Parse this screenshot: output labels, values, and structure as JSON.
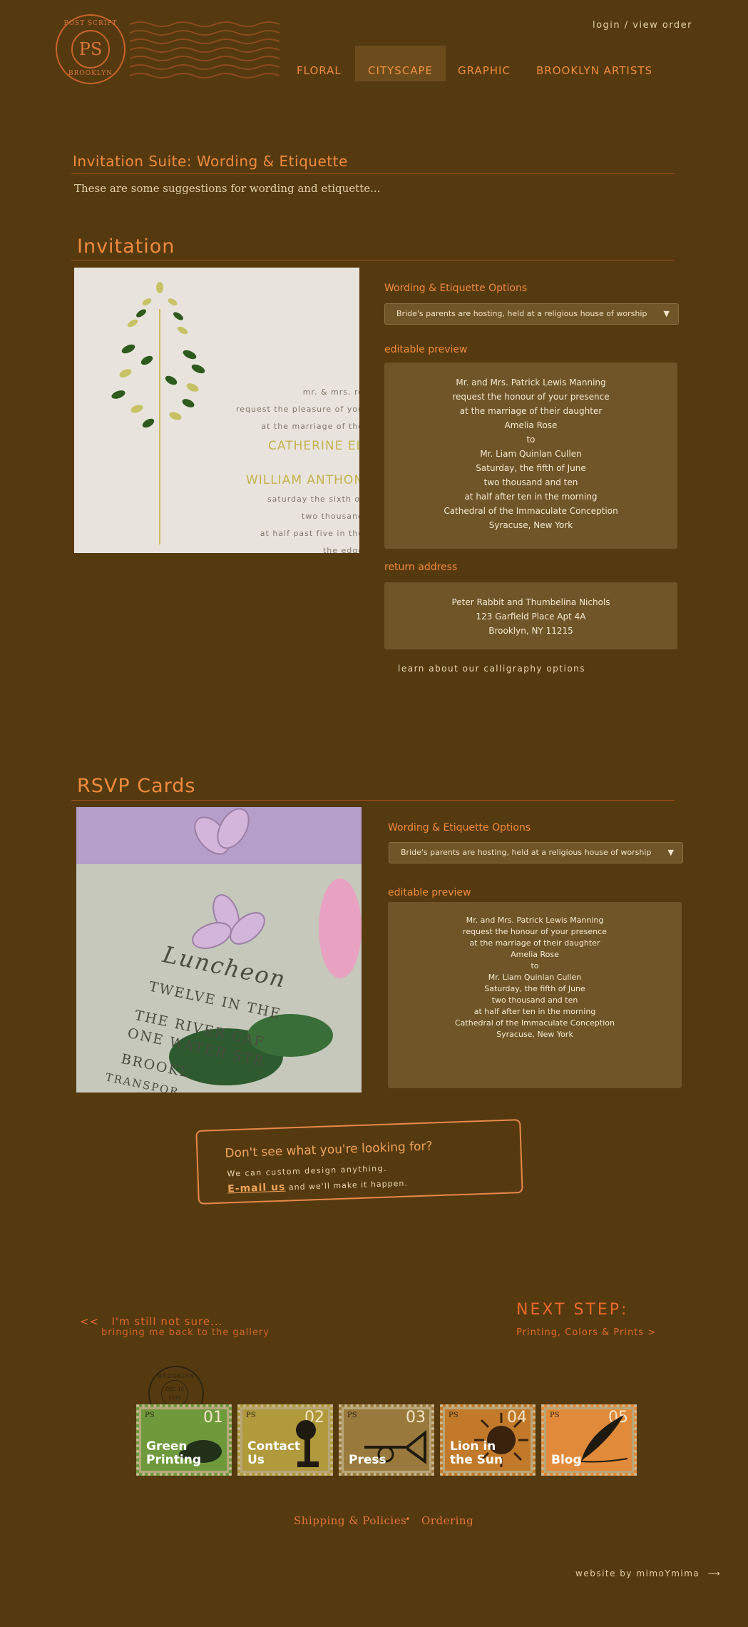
{
  "header": {
    "logo": {
      "top": "POST SCRIPT",
      "mono": "PS",
      "bottom": "BROOKLYN"
    },
    "login": "login / view order",
    "nav": [
      "FLORAL",
      "CITYSCAPE",
      "GRAPHIC",
      "BROOKLYN ARTISTS"
    ],
    "active_nav": "CITYSCAPE"
  },
  "page": {
    "title": "Invitation Suite: Wording & Etiquette",
    "intro": "These are some suggestions for wording and etiquette..."
  },
  "invitation": {
    "title": "Invitation",
    "photo_text": {
      "line1": "mr. & mrs. ro",
      "line2": "request the pleasure of you",
      "line3": "at the marriage of the",
      "name1": "CATHERINE EL",
      "name2": "WILLIAM ANTHON",
      "line4": "saturday the sixth of",
      "line5": "two thousand",
      "line6": "at half past five in the",
      "line7": "the edge"
    },
    "options_label": "Wording & Etiquette Options",
    "option_selected": "Bride's parents are hosting, held at a religious house of worship",
    "preview_label": "editable preview",
    "preview_lines": [
      "Mr. and Mrs. Patrick Lewis Manning",
      "request the honour of your presence",
      "at the marriage of their daughter",
      "Amelia Rose",
      "to",
      "Mr. Liam Quinlan Cullen",
      "Saturday, the fifth of June",
      "two thousand and ten",
      "at half after ten in the morning",
      "Cathedral of the Immaculate Conception",
      "Syracuse, New York"
    ],
    "return_label": "return address",
    "return_lines": [
      "Peter Rabbit and Thumbelina Nichols",
      "123 Garfield Place Apt 4A",
      "Brooklyn, NY 11215"
    ],
    "calligraphy_link": "learn about our calligraphy options"
  },
  "rsvp": {
    "title": "RSVP Cards",
    "photo_text": {
      "line1": "Luncheon",
      "line2": "TWELVE IN THE",
      "line3": "THE RIVER CAF",
      "line4": "ONE WATER STR",
      "line5": "BROOKL",
      "line6": "TRANSPOR"
    },
    "options_label": "Wording & Etiquette Options",
    "option_selected": "Bride's parents are hosting, held at a religious house of worship",
    "preview_label": "editable preview",
    "preview_lines": [
      "Mr. and Mrs. Patrick Lewis Manning",
      "request the honour of your presence",
      "at the marriage of their daughter",
      "Amelia Rose",
      "to",
      "Mr. Liam Quinlan Cullen",
      "Saturday, the fifth of June",
      "two thousand and ten",
      "at half after ten in the morning",
      "Cathedral of the Immaculate Conception",
      "Syracuse, New York"
    ]
  },
  "custom": {
    "question": "Don't see what you're looking for?",
    "line1": "We can custom design anything.",
    "email_link": "E-mail us",
    "line2_rest": "and we'll make it happen."
  },
  "pager": {
    "prev_arrows": "<<",
    "prev_title": "I'm still not sure...",
    "prev_sub": "bringing me back to the gallery",
    "next_title": "NEXT STEP:",
    "next_sub": "Printing, Colors & Prints >"
  },
  "postmark": {
    "ring": "BROOKLYN",
    "date": "DEC 10 2010",
    "state": "N.Y."
  },
  "stamps": [
    {
      "num": "01",
      "ps": "PS",
      "label1": "Green",
      "label2": "Printing",
      "color": "#6f9a3c"
    },
    {
      "num": "02",
      "ps": "PS",
      "label1": "Contact",
      "label2": "Us",
      "color": "#b09a3c"
    },
    {
      "num": "03",
      "ps": "PS",
      "label1": "Press",
      "label2": "",
      "color": "#9a7a3c"
    },
    {
      "num": "04",
      "ps": "PS",
      "label1": "Lion in",
      "label2": "the Sun",
      "color": "#c27a2a"
    },
    {
      "num": "05",
      "ps": "PS",
      "label1": "Blog",
      "label2": "",
      "color": "#e08a3a"
    }
  ],
  "footer": {
    "shipping": "Shipping & Policies",
    "dot": "•",
    "ordering": "Ordering",
    "credit": "website by mimoYmima"
  },
  "colors": {
    "background": "#553a10",
    "accent": "#f08a3c",
    "panel": "#6f5527"
  }
}
